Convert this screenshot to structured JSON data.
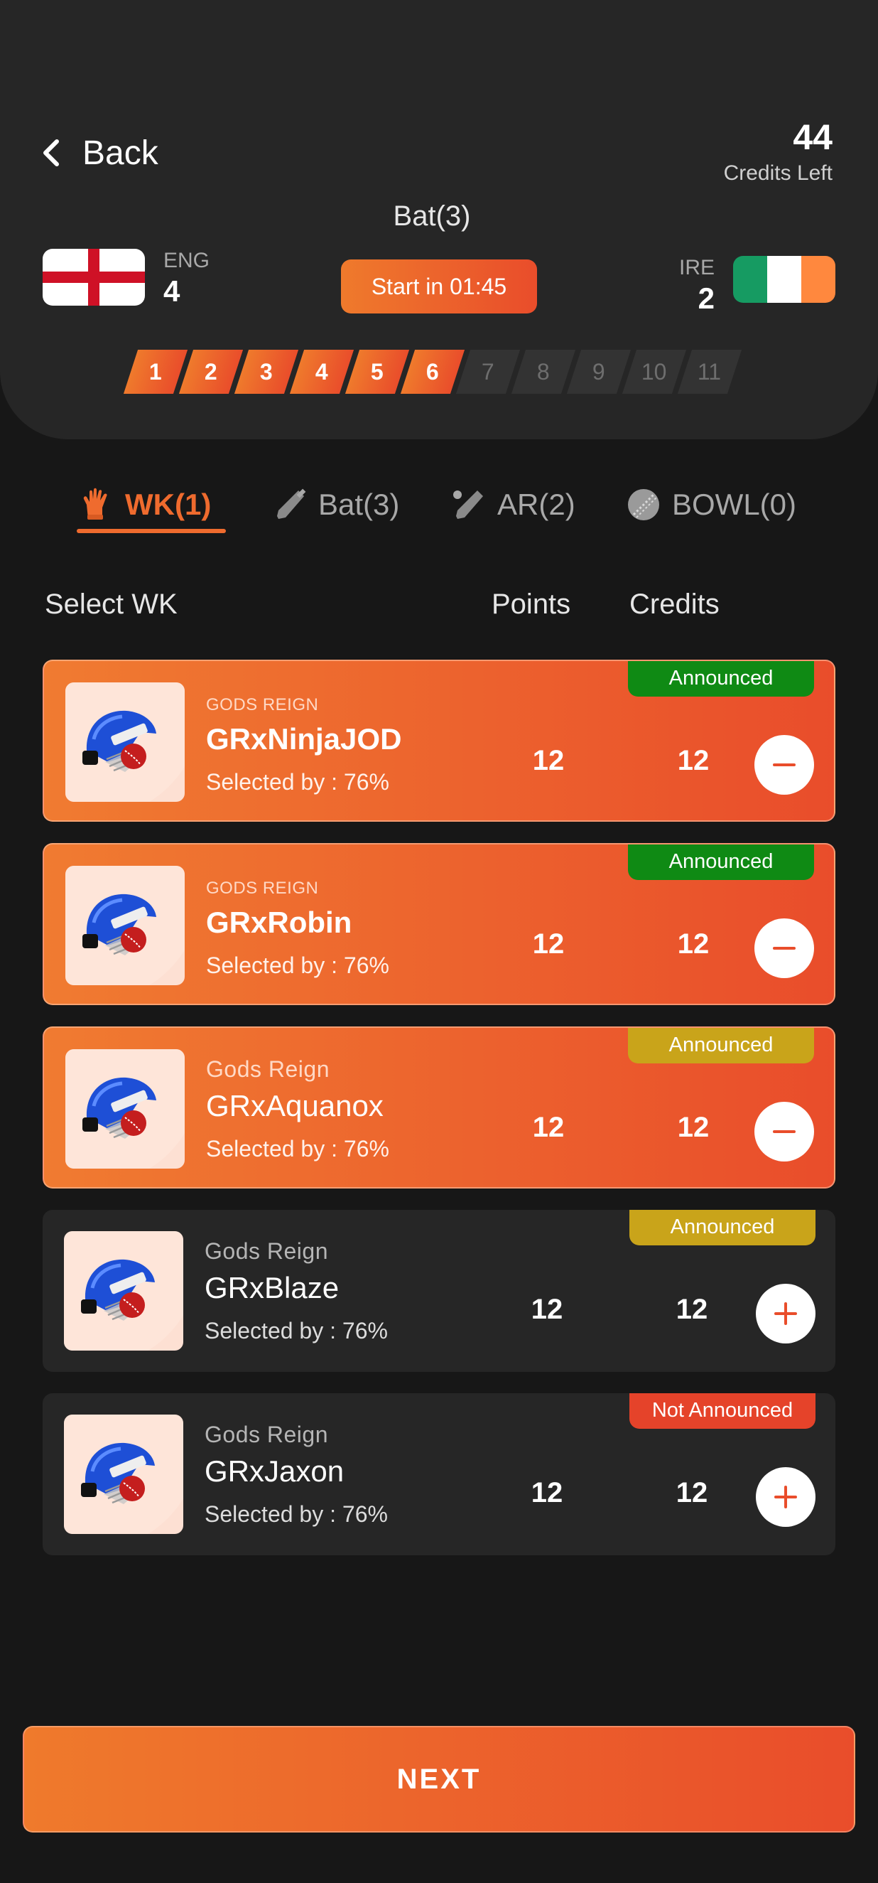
{
  "header": {
    "back_label": "Back",
    "credits_value": "44",
    "credits_label": "Credits Left",
    "current_count": "Bat(3)",
    "timer": "Start in 01:45",
    "team_left": {
      "code": "ENG",
      "score": "4"
    },
    "team_right": {
      "code": "IRE",
      "score": "2"
    },
    "steps": [
      "1",
      "2",
      "3",
      "4",
      "5",
      "6",
      "7",
      "8",
      "9",
      "10",
      "11"
    ],
    "steps_filled": 6
  },
  "tabs": [
    {
      "label": "WK(1)",
      "icon": "wicketkeeper-glove-icon",
      "active": true
    },
    {
      "label": "Bat(3)",
      "icon": "bat-icon",
      "active": false
    },
    {
      "label": "AR(2)",
      "icon": "allrounder-icon",
      "active": false
    },
    {
      "label": "BOWL(0)",
      "icon": "ball-icon",
      "active": false
    }
  ],
  "columns": {
    "select": "Select WK",
    "points": "Points",
    "credits": "Credits"
  },
  "players": [
    {
      "team": "GODS REIGN",
      "name": "GRxNinjaJOD",
      "selected_by": "Selected by : 76%",
      "points": "12",
      "credits": "12",
      "status": "Announced",
      "status_color": "#0f8a14",
      "selected": true
    },
    {
      "team": "GODS REIGN",
      "name": "GRxRobin",
      "selected_by": "Selected by : 76%",
      "points": "12",
      "credits": "12",
      "status": "Announced",
      "status_color": "#0f8a14",
      "selected": true
    },
    {
      "team": "Gods Reign",
      "name": "GRxAquanox",
      "selected_by": "Selected by : 76%",
      "points": "12",
      "credits": "12",
      "status": "Announced",
      "status_color": "#c9a41a",
      "selected": true
    },
    {
      "team": "Gods Reign",
      "name": "GRxBlaze",
      "selected_by": "Selected by : 76%",
      "points": "12",
      "credits": "12",
      "status": "Announced",
      "status_color": "#c9a41a",
      "selected": false
    },
    {
      "team": "Gods Reign",
      "name": "GRxJaxon",
      "selected_by": "Selected by : 76%",
      "points": "12",
      "credits": "12",
      "status": "Not Announced",
      "status_color": "#e5432a",
      "selected": false
    }
  ],
  "next_label": "NEXT",
  "colors": {
    "accent": "#ef6b2e",
    "background": "#171717",
    "panel": "#262626"
  }
}
